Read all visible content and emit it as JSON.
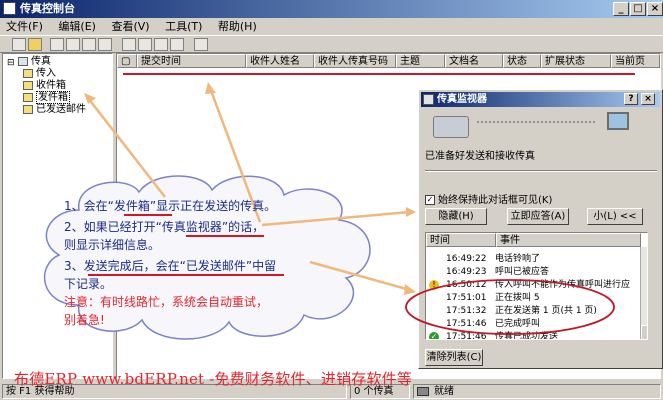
{
  "window": {
    "title": "传真控制台"
  },
  "menu": [
    "文件(F)",
    "编辑(E)",
    "查看(V)",
    "工具(T)",
    "帮助(H)"
  ],
  "tree": {
    "root": "传真",
    "items": [
      "传入",
      "收件箱",
      "发件箱",
      "已发送邮件"
    ],
    "selected": "发件箱"
  },
  "columns": [
    "提交时间",
    "收件人姓名",
    "收件人传真号码",
    "主题",
    "文档名",
    "状态",
    "扩展状态",
    "当前页"
  ],
  "statusbar": {
    "help": "按 F1 获得帮助",
    "count": "0 个传真",
    "ready": "就绪"
  },
  "monitor": {
    "title": "传真监视器",
    "status": "已准备好发送和接收传真",
    "keep_visible": "始终保持此对话框可见(K)",
    "hide_button": "隐藏(H)",
    "answer_button": "立即应答(A)",
    "small_button": "小(L) <<",
    "log_headers": [
      "时间",
      "事件"
    ],
    "log": [
      {
        "time": "16:49:22",
        "event": "电话铃响了",
        "icon": "none"
      },
      {
        "time": "16:49:23",
        "event": "呼叫已被应答",
        "icon": "none"
      },
      {
        "time": "16:50:12",
        "event": "传入呼叫不能作为传真呼叫进行应",
        "icon": "warning-icon"
      },
      {
        "time": "17:51:01",
        "event": "正在拨叫 5",
        "icon": "none"
      },
      {
        "time": "17:51:32",
        "event": "正在发送第 1 页(共 1 页)",
        "icon": "none"
      },
      {
        "time": "17:51:46",
        "event": "已完成呼叫",
        "icon": "none"
      },
      {
        "time": "17:51:46",
        "event": "传真已成功发送",
        "icon": "success-icon"
      }
    ],
    "clear_button": "清除列表(C)"
  },
  "annotation": {
    "line1": "1、会在“发件箱”显示正在发送的传真。",
    "line2a": "2、如果已经打开“传真监视器”的话，",
    "line2b": "则显示详细信息。",
    "line3a": "3、发送完成后，会在“已发送邮件”中留",
    "line3b": "下记录。",
    "warn1": "注意：有时线路忙，系统会自动重试，",
    "warn2": "别着急!"
  },
  "banner": "布德ERP www.bdERP.net -免费财务软件、进销存软件等",
  "colors": {
    "annotation": "#1a2c8a",
    "highlight": "#e3262e",
    "titlebar": "#0a246a",
    "arrow": "#f2b77a"
  }
}
